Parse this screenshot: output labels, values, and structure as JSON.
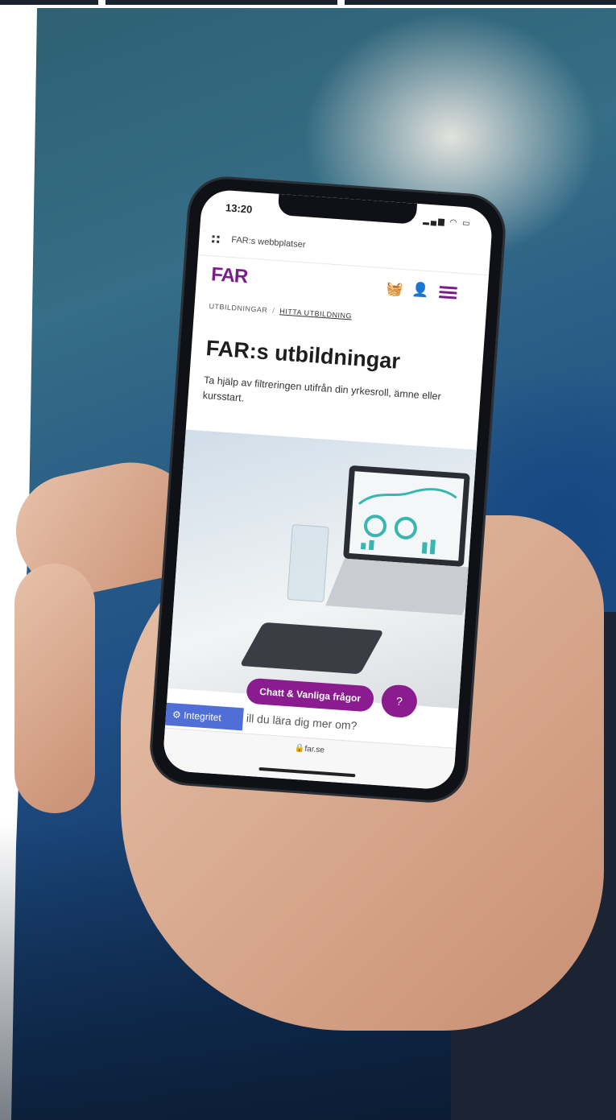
{
  "phone": {
    "status_time": "13:20",
    "status_icons": "signal wifi battery",
    "sites_bar_label": "FAR:s webbplatser",
    "logo_text": "FAR",
    "breadcrumb": {
      "first": "UTBILDNINGAR",
      "separator": "/",
      "current": "HITTA UTBILDNING"
    },
    "hero_title": "FAR:s utbildningar",
    "hero_text": "Ta hjälp av filtreringen utifrån din yrkesroll, ämne eller kursstart.",
    "chat_button_label": "Chatt & Vanliga frågor",
    "help_button_label": "?",
    "privacy_button_label": "Integritet",
    "question_text": "ill du lära dig mer om?",
    "url_text": "far.se",
    "icons": [
      "grid-icon",
      "cart-icon",
      "user-icon",
      "menu-icon",
      "gear-icon",
      "lock-icon",
      "chat-bubble-icon"
    ]
  },
  "colors": {
    "brand_purple": "#8a1c8f",
    "privacy_blue": "#4f6fd6",
    "background_blue": "#1f4f86"
  }
}
